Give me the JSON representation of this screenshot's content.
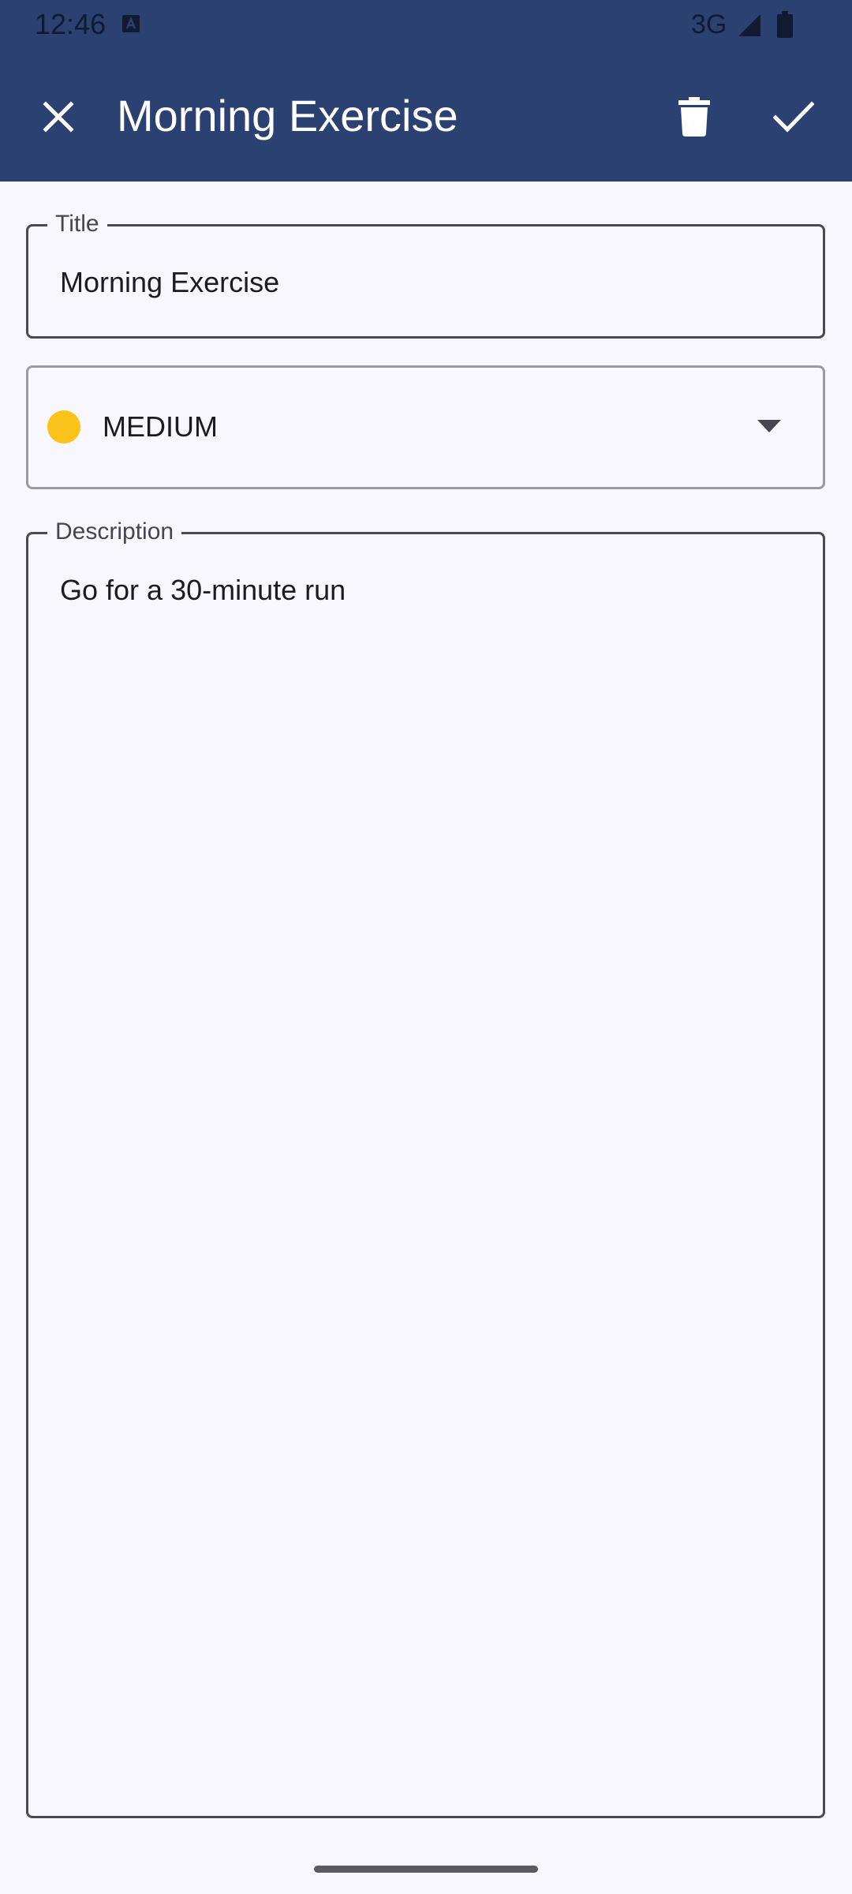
{
  "status_bar": {
    "time": "12:46",
    "network": "3G"
  },
  "toolbar": {
    "title": "Morning Exercise",
    "close_icon": "close-icon",
    "delete_icon": "delete-icon",
    "save_icon": "check-icon"
  },
  "form": {
    "title": {
      "label": "Title",
      "value": "Morning Exercise"
    },
    "priority": {
      "value": "MEDIUM",
      "color": "#fbc21a"
    },
    "description": {
      "label": "Description",
      "value": "Go for a 30-minute run"
    }
  },
  "colors": {
    "app_bar": "#2b4172",
    "background": "#f7f7fd",
    "on_primary": "#ffffff"
  }
}
